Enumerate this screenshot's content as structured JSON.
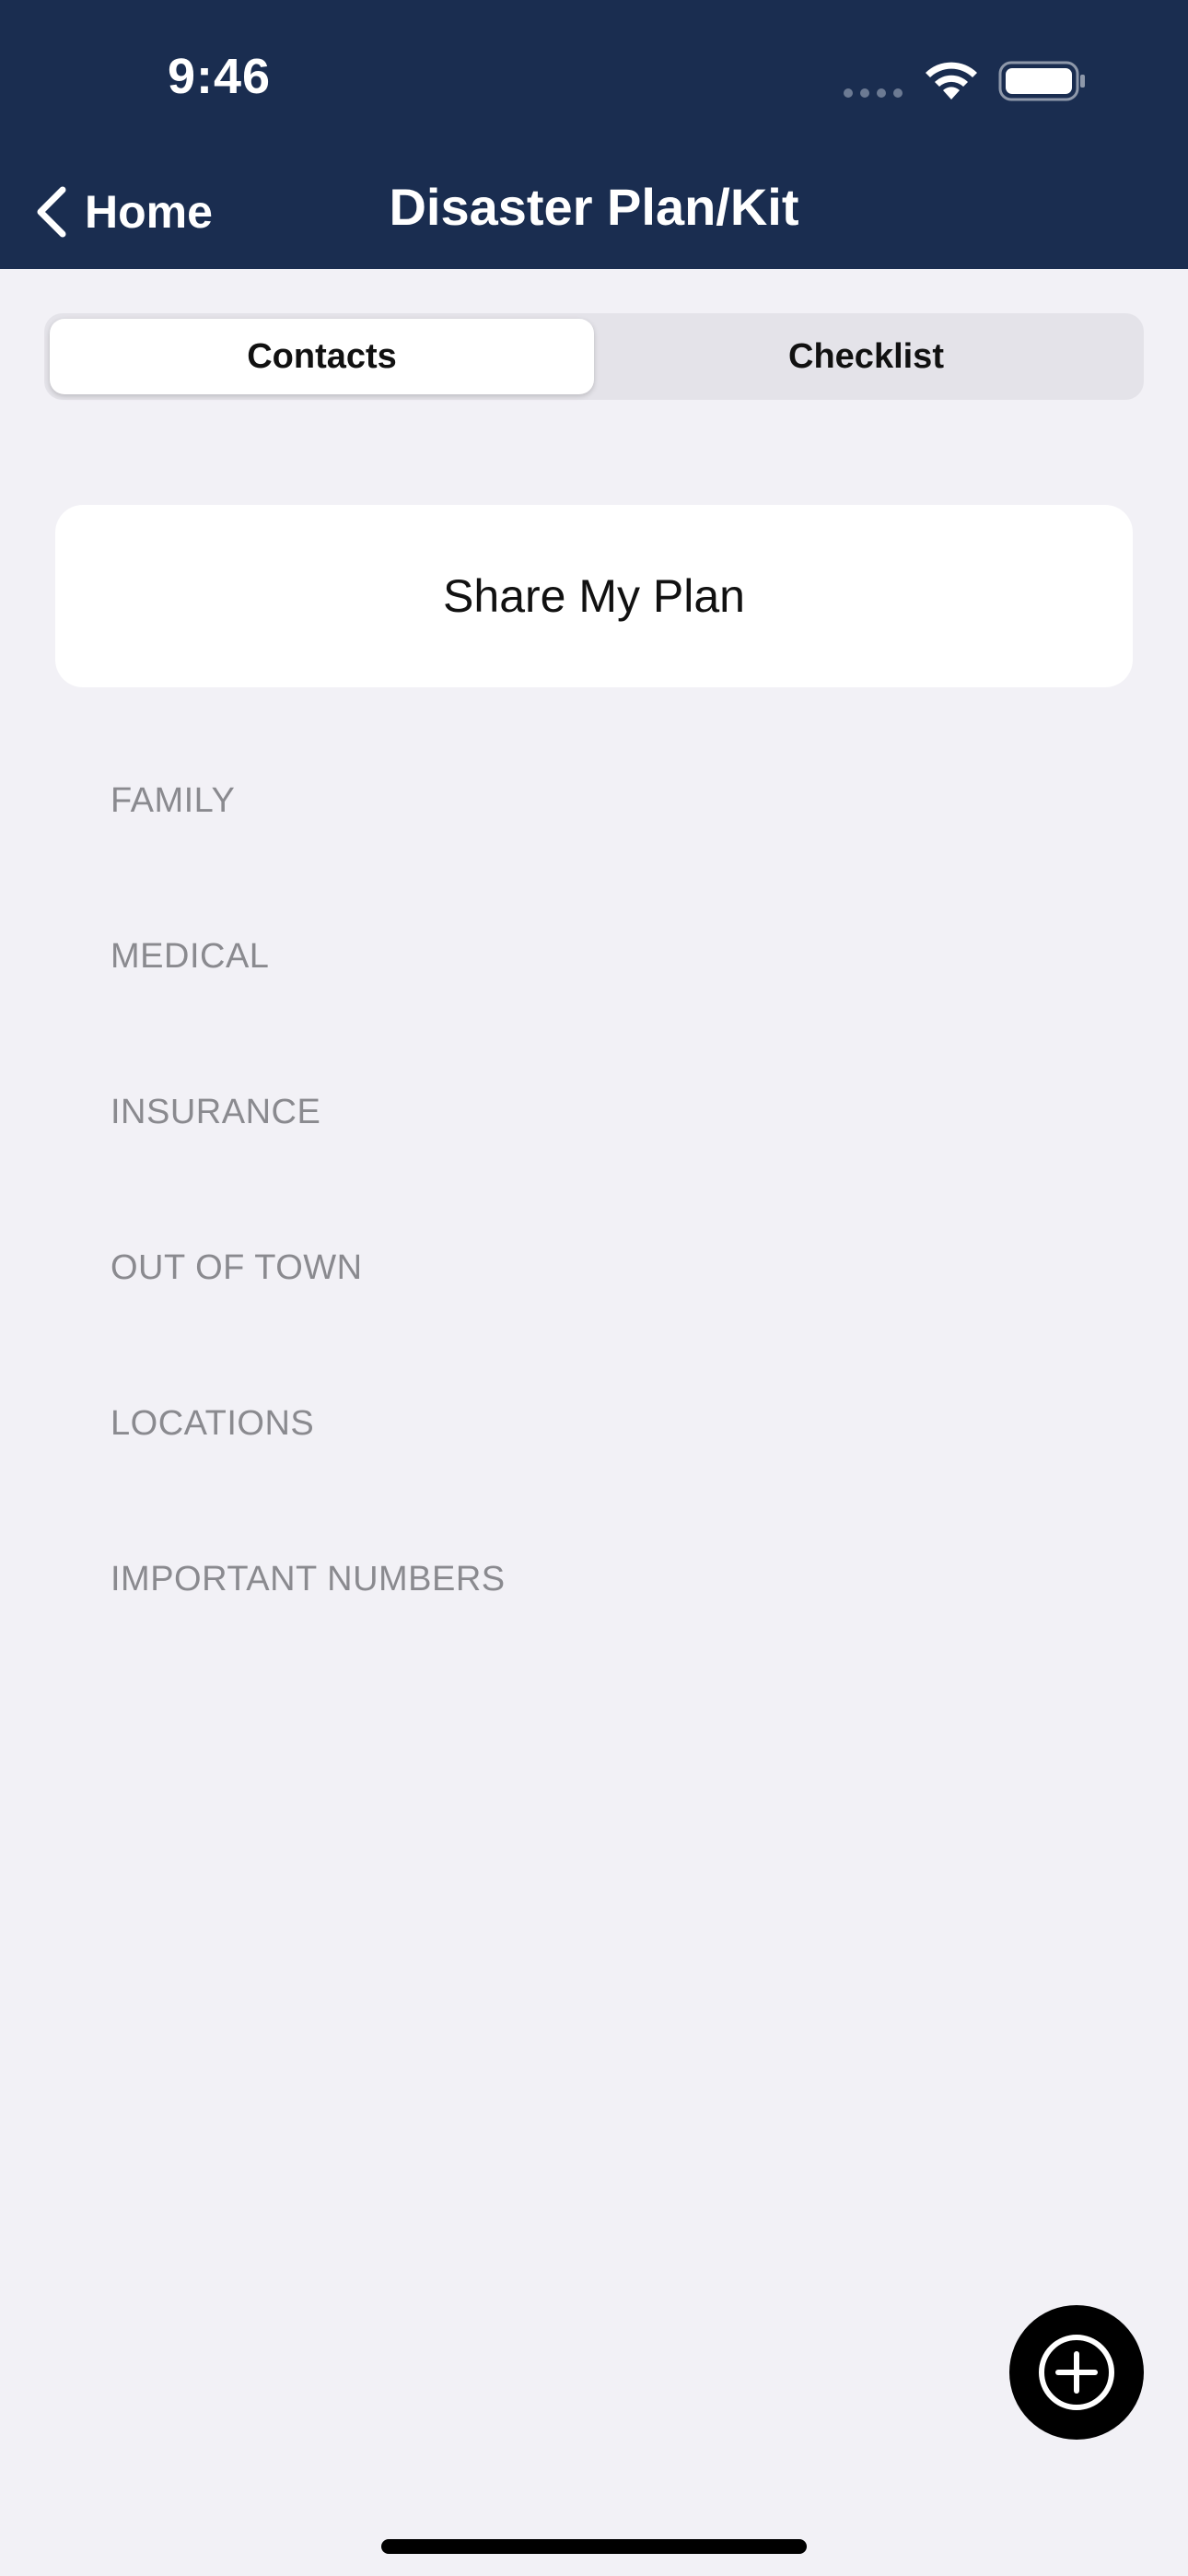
{
  "status_bar": {
    "time": "9:46",
    "icons": [
      "signal-dots-icon",
      "wifi-icon",
      "battery-icon"
    ]
  },
  "nav": {
    "back_label": "Home",
    "title": "Disaster Plan/Kit"
  },
  "tabs": [
    {
      "label": "Contacts",
      "selected": true
    },
    {
      "label": "Checklist",
      "selected": false
    }
  ],
  "share_button": {
    "label": "Share My Plan"
  },
  "sections": [
    {
      "label": "FAMILY"
    },
    {
      "label": "MEDICAL"
    },
    {
      "label": "INSURANCE"
    },
    {
      "label": "OUT OF TOWN"
    },
    {
      "label": "LOCATIONS"
    },
    {
      "label": "IMPORTANT NUMBERS"
    }
  ],
  "fab": {
    "icon": "add-circle-icon"
  },
  "colors": {
    "header_bg": "#1A2D50",
    "page_bg": "#F2F1F6",
    "section_text": "#8A8A8F"
  }
}
